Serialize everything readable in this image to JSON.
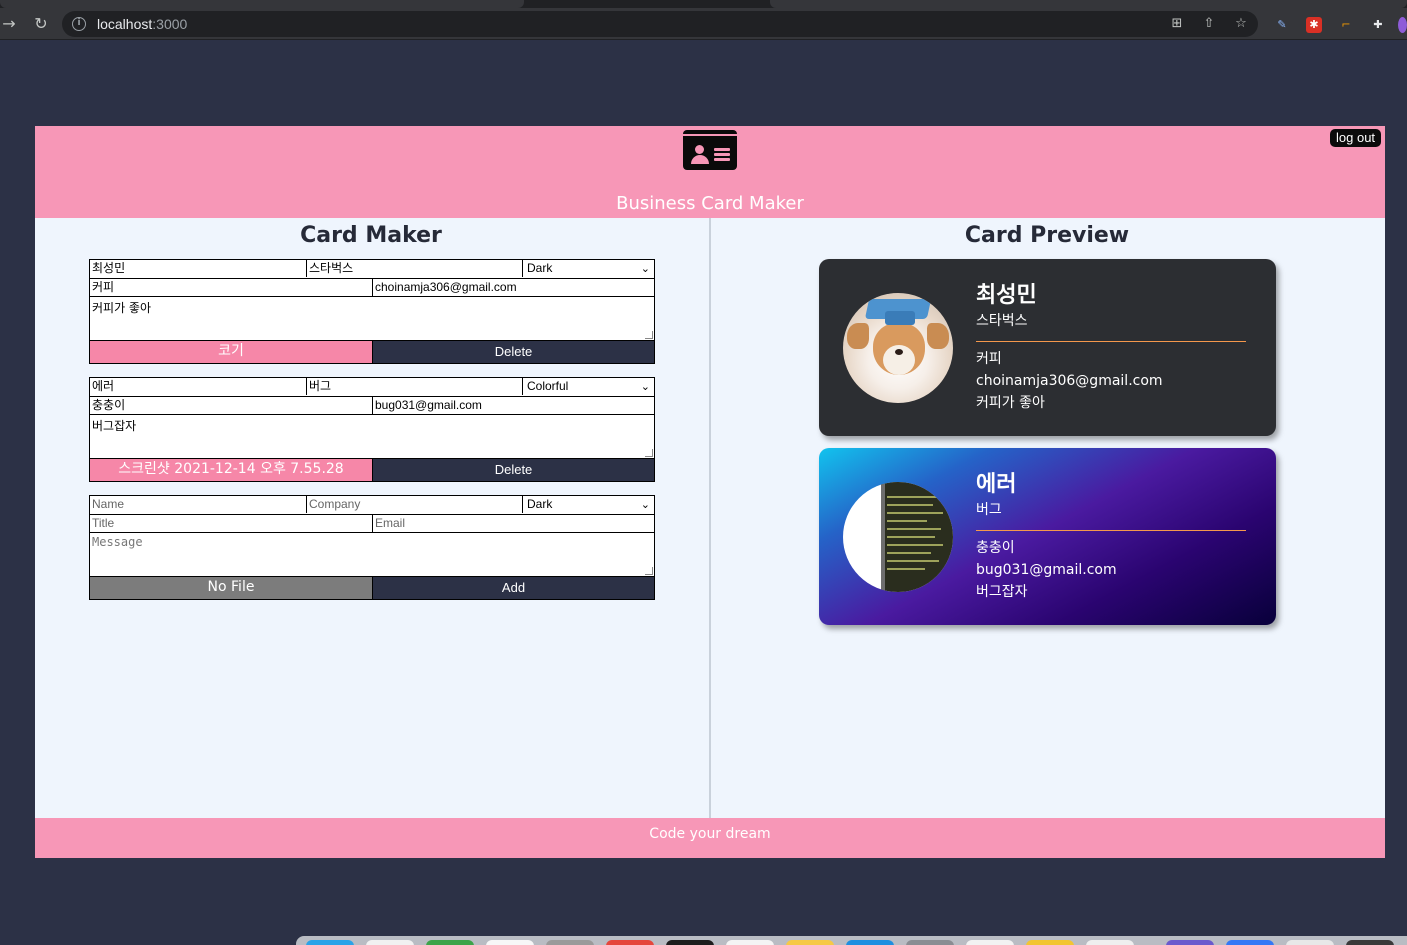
{
  "browser": {
    "url_host": "localhost",
    "url_port": ":3000"
  },
  "header": {
    "title": "Business Card Maker",
    "logout_label": "log out"
  },
  "maker": {
    "title": "Card Maker",
    "cards": [
      {
        "name": "최성민",
        "company": "스타벅스",
        "theme": "Dark",
        "title": "커피",
        "email": "choinamja306@gmail.com",
        "message": "커피가 좋아",
        "file": "코기",
        "action": "Delete"
      },
      {
        "name": "에러",
        "company": "버그",
        "theme": "Colorful",
        "title": "충충이",
        "email": "bug031@gmail.com",
        "message": "버그잡자",
        "file": "스크린샷 2021-12-14 오후 7.55.28",
        "action": "Delete"
      }
    ],
    "add_form": {
      "name_placeholder": "Name",
      "company_placeholder": "Company",
      "theme": "Dark",
      "title_placeholder": "Title",
      "email_placeholder": "Email",
      "message_placeholder": "Message",
      "file": "No File",
      "action": "Add"
    }
  },
  "preview": {
    "title": "Card Preview",
    "cards": [
      {
        "name": "최성민",
        "company": "스타벅스",
        "title": "커피",
        "email": "choinamja306@gmail.com",
        "message": "커피가 좋아",
        "theme": "dark"
      },
      {
        "name": "에러",
        "company": "버그",
        "title": "충충이",
        "email": "bug031@gmail.com",
        "message": "버그잡자",
        "theme": "colorful"
      }
    ]
  },
  "footer": {
    "text": "Code your dream"
  },
  "colors": {
    "page_background": "#2c3146",
    "brand_pink": "#f797b7",
    "content_background": "#eff5fd",
    "dark_card": "#2c2e32",
    "button_navy": "#2c3146",
    "accent_rule": "#f5984c"
  }
}
